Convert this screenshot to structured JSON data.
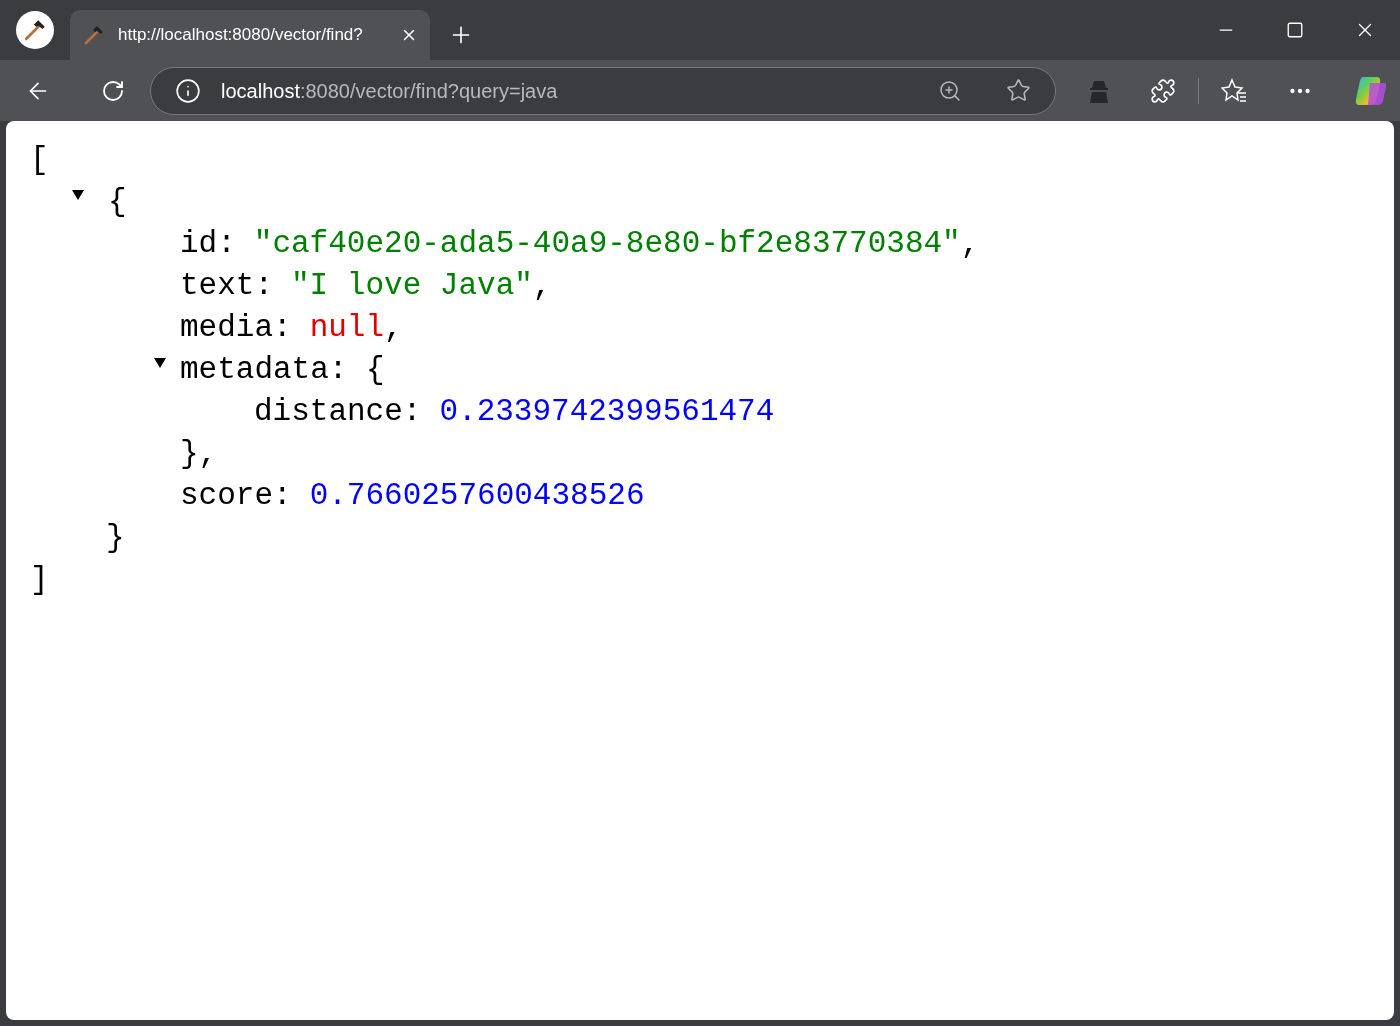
{
  "browser": {
    "tab": {
      "title": "http://localhost:8080/vector/find?",
      "selected": true
    },
    "address": {
      "host": "localhost",
      "rest": ":8080/vector/find?query=java"
    }
  },
  "json_view": {
    "open": "[",
    "close": "]",
    "items": [
      {
        "expanded": true,
        "open": "{",
        "close": "}",
        "fields": [
          {
            "kind": "string",
            "key": "id:",
            "value": "\"caf40e20-ada5-40a9-8e80-bf2e83770384\"",
            "punct": ","
          },
          {
            "kind": "string",
            "key": "text:",
            "value": "\"I love Java\"",
            "punct": ","
          },
          {
            "kind": "null",
            "key": "media:",
            "value": "null",
            "punct": ","
          },
          {
            "kind": "object",
            "key": "metadata:",
            "open": "{",
            "close": "},",
            "expanded": true,
            "fields": [
              {
                "kind": "number",
                "key": "distance:",
                "value": "0.2339742399561474"
              }
            ]
          },
          {
            "kind": "number",
            "key": "score:",
            "value": "0.7660257600438526"
          }
        ]
      }
    ]
  }
}
